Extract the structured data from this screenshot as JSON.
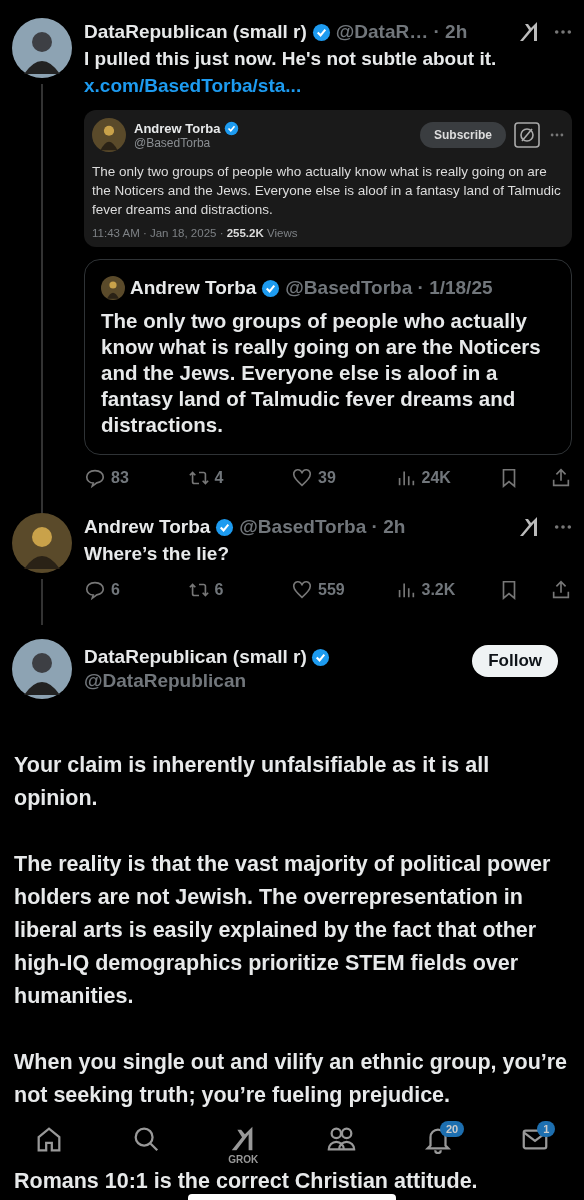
{
  "thread": [
    {
      "name": "DataRepublican (small r)",
      "verified": true,
      "handle_time": "@DataR… · 2h",
      "text": "I pulled this just now. He's not subtle about it.",
      "link": "x.com/BasedTorba/sta...",
      "screenshot": {
        "name": "Andrew Torba",
        "verified": true,
        "handle": "@BasedTorba",
        "button": "Subscribe",
        "text": "The only two groups of people who actually know what is really going on are the Noticers and the Jews. Everyone else is aloof in a fantasy land of Talmudic fever dreams and distractions.",
        "meta": "11:43 AM · Jan 18, 2025 · **255.2K** Views"
      },
      "quote": {
        "name": "Andrew Torba",
        "verified": true,
        "handle_time": "@BasedTorba · 1/18/25",
        "text": "The only two groups of people who actually know what is really going on are the Noticers and the Jews. Everyone else is aloof in a fantasy land of Talmudic fever dreams and distractions."
      },
      "stats": [
        {
          "kind": "replies",
          "count": "83"
        },
        {
          "kind": "reposts",
          "count": "4"
        },
        {
          "kind": "likes",
          "count": "39"
        },
        {
          "kind": "views",
          "count": "24K"
        },
        {
          "kind": "bookmark"
        },
        {
          "kind": "share"
        }
      ]
    },
    {
      "name": "Andrew Torba",
      "verified": true,
      "handle_time": "@BasedTorba · 2h",
      "text": "Where’s the lie?",
      "stats": [
        {
          "kind": "replies",
          "count": "6"
        },
        {
          "kind": "reposts",
          "count": "6"
        },
        {
          "kind": "likes",
          "count": "559"
        },
        {
          "kind": "views",
          "count": "3.2K"
        },
        {
          "kind": "bookmark"
        },
        {
          "kind": "share"
        }
      ]
    }
  ],
  "focused": {
    "name": "DataRepublican (small r)",
    "verified": true,
    "handle": "@DataRepublican",
    "follow": "Follow",
    "paragraphs": [
      "Your claim is inherently unfalsifiable as it is all opinion.",
      "The reality is that the vast majority of political power holders are not Jewish. The overrepresentation in liberal arts is easily explained by the fact that other high-IQ demographics prioritize STEM fields over humanities.",
      "When you single out and vilify an ethnic group, you’re not seeking truth; you’re fueling prejudice.",
      "Romans 10:1 is the correct Christian attitude."
    ]
  },
  "bottom_nav": [
    {
      "kind": "home"
    },
    {
      "kind": "search"
    },
    {
      "kind": "grok",
      "label": "GROK"
    },
    {
      "kind": "communities"
    },
    {
      "kind": "notifications",
      "badge": "20"
    },
    {
      "kind": "messages",
      "badge": "1"
    }
  ]
}
